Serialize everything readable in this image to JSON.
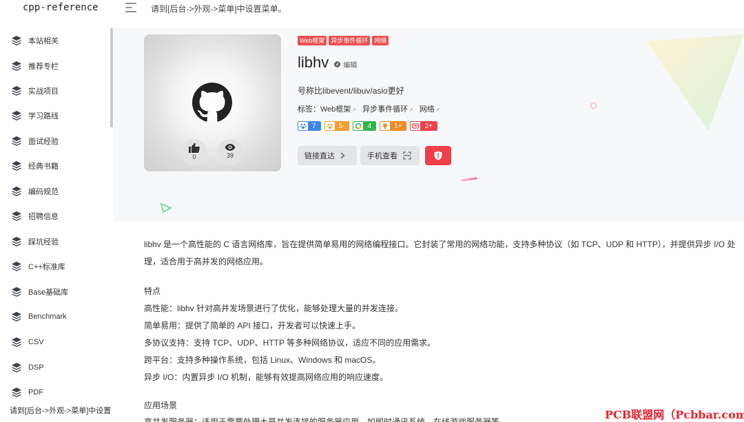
{
  "header": {
    "logo": "cpp-reference",
    "menu_hint": "请到[后台->外观->菜单]中设置菜单。"
  },
  "sidebar": {
    "items": [
      {
        "label": "本站相关"
      },
      {
        "label": "推荐专栏"
      },
      {
        "label": "实战项目"
      },
      {
        "label": "学习路线"
      },
      {
        "label": "面试经验"
      },
      {
        "label": "经典书籍"
      },
      {
        "label": "编码规范"
      },
      {
        "label": "招聘信息"
      },
      {
        "label": "踩坑经验"
      },
      {
        "label": "C++标准库"
      },
      {
        "label": "Base基础库"
      },
      {
        "label": "Benchmark"
      },
      {
        "label": "CSV"
      },
      {
        "label": "DSP"
      },
      {
        "label": "PDF"
      }
    ],
    "footer": "请到[后台->外观->菜单]中设置菜单。",
    "icon": "layers-icon"
  },
  "project": {
    "tags": [
      "Web框架",
      "异步事件循环",
      "网络"
    ],
    "title": "libhv",
    "edit": "编辑",
    "subtitle": "号称比libevent/libuv/asio更好",
    "tag_line": {
      "prefix": "标签：",
      "items": [
        "Web框架",
        "异步事件循环",
        "网络"
      ]
    },
    "stats": {
      "likes": "0",
      "views": "39"
    },
    "badges": [
      {
        "value": "7",
        "color": "#3d86e8"
      },
      {
        "value": "5-",
        "color": "#f59d2a"
      },
      {
        "value": "4",
        "color": "#2fb64a"
      },
      {
        "value": "1+",
        "color": "#f08c24"
      },
      {
        "value": "2+",
        "color": "#ef3f48"
      }
    ],
    "buttons": {
      "link": "链接直达",
      "mobile": "手机查看"
    }
  },
  "article": {
    "description": "libhv 是一个高性能的 C 语言网络库，旨在提供简单易用的网络编程接口。它封装了常用的网络功能，支持多种协议（如 TCP、UDP 和 HTTP），并提供异步 I/O 处理，适合用于高并发的网络应用。",
    "features_title": "特点",
    "features": [
      "高性能：libhv 针对高并发场景进行了优化，能够处理大量的并发连接。",
      "简单易用：提供了简单的 API 接口，开发者可以快速上手。",
      "多协议支持：支持 TCP、UDP、HTTP 等多种网络协议，适应不同的应用需求。",
      "跨平台：支持多种操作系统，包括 Linux、Windows 和 macOS。",
      "异步 I/O：内置异步 I/O 机制，能够有效提高网络应用的响应速度。"
    ],
    "scenarios_title": "应用场景",
    "scenario_first": "高并发服务器：适用于需要处理大量并发连接的服务器应用，如即时通讯系统、在线游戏服务器等。"
  },
  "watermark": "PCB联盟网（Pcbbar.com）",
  "colors": {
    "accent": "#ee4d4d",
    "watermark": "#e8232c"
  }
}
